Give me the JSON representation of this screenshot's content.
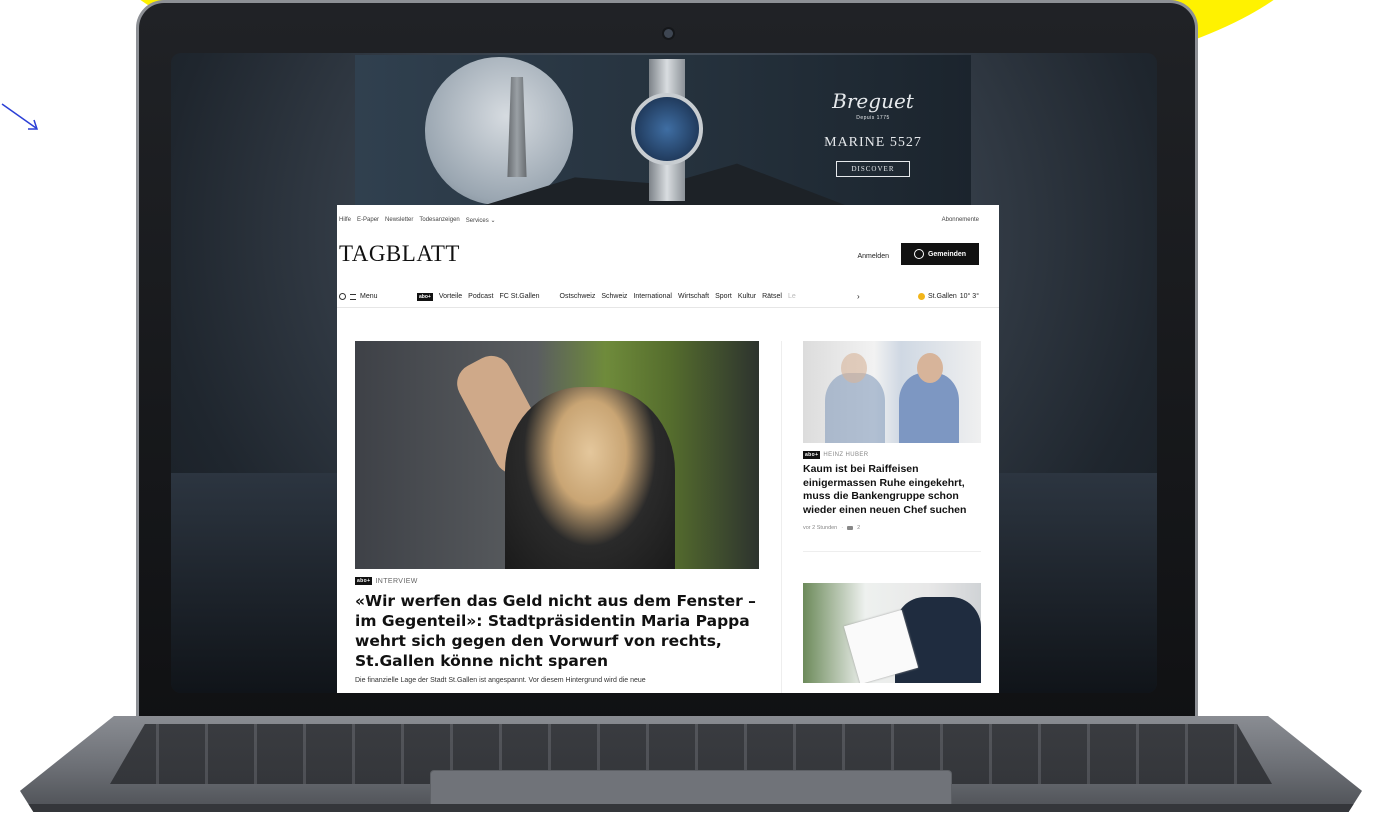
{
  "ad": {
    "brand": "Breguet",
    "brand_sub": "Depuis 1775",
    "title": "MARINE 5527",
    "cta": "DISCOVER"
  },
  "site": {
    "utility_nav": [
      "Hilfe",
      "E-Paper",
      "Newsletter",
      "Todesanzeigen",
      "Services"
    ],
    "subscriptions": "Abonnemente",
    "logo": "TAGBLATT",
    "login": "Anmelden",
    "join": "Gemeinden",
    "menu_label": "Menu",
    "plus_badge": "abo+",
    "nav_items_primary": [
      "Vorteile",
      "Podcast",
      "FC St.Gallen"
    ],
    "nav_items_secondary": [
      "Ostschweiz",
      "Schweiz",
      "International",
      "Wirtschaft",
      "Sport",
      "Kultur",
      "Rätsel"
    ],
    "nav_faded": "Le",
    "weather": {
      "city": "St.Gallen",
      "temps": "10° 3°"
    }
  },
  "main_article": {
    "tag": "INTERVIEW",
    "headline": "«Wir werfen das Geld nicht aus dem Fenster – im Gegenteil»: Stadtpräsidentin Maria Pappa wehrt sich gegen den Vorwurf von rechts, St.Gallen könne nicht sparen",
    "lead": "Die finanzielle Lage der Stadt St.Gallen ist angespannt. Vor diesem Hintergrund wird die neue"
  },
  "side_article_1": {
    "author": "HEINZ HUBER",
    "headline": "Kaum ist bei Raiffeisen einigermassen Ruhe eingekehrt, muss die Bankengruppe schon wieder einen neuen Chef suchen",
    "time": "vor 2 Stunden",
    "comments": "2"
  },
  "colors": {
    "accent_yellow": "#fff200",
    "nav_dark": "#111111"
  }
}
